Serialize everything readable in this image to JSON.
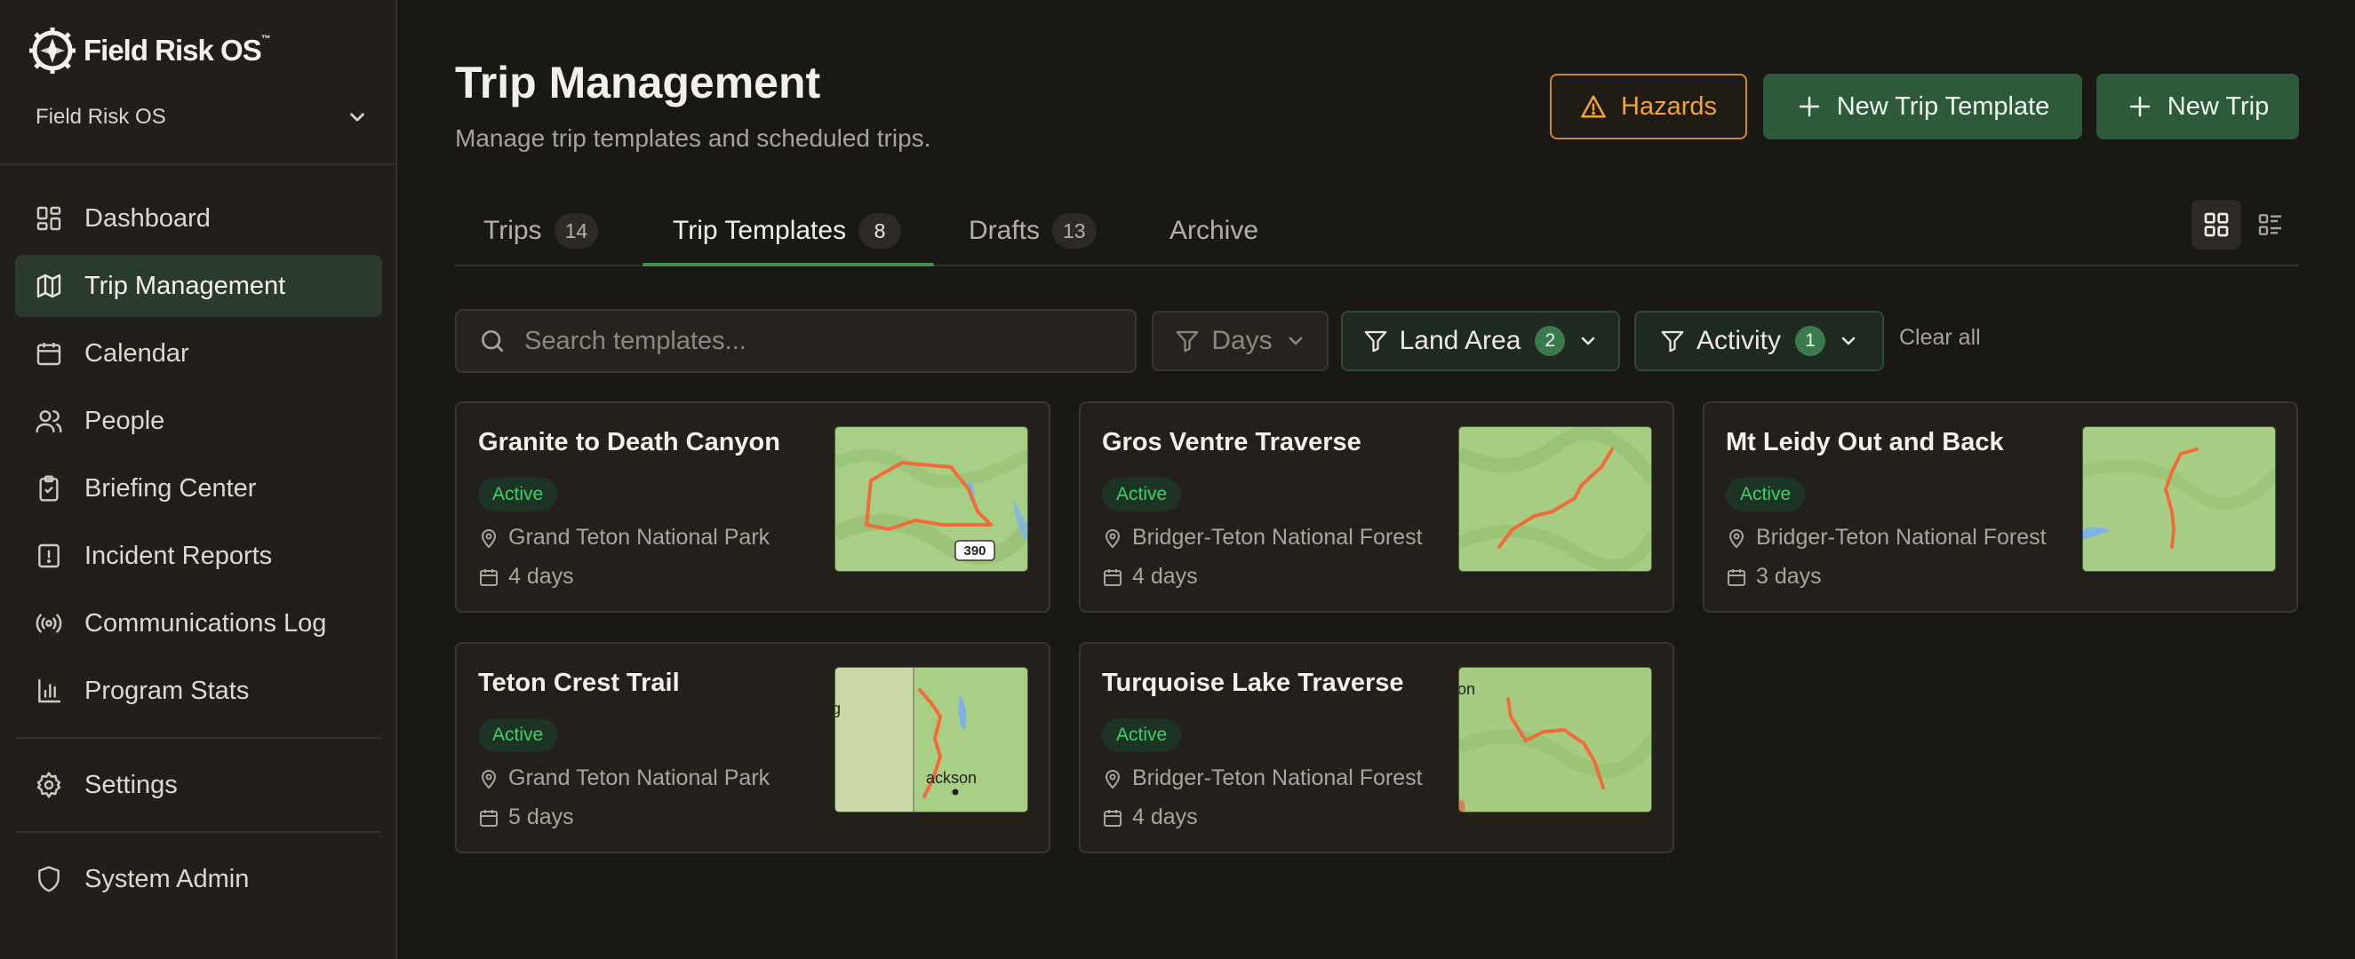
{
  "brand": {
    "name": "Field Risk OS",
    "trademark": "™"
  },
  "org": {
    "name": "Field Risk OS"
  },
  "nav": {
    "items": [
      {
        "label": "Dashboard",
        "icon": "dashboard-icon"
      },
      {
        "label": "Trip Management",
        "icon": "map-icon",
        "active": true
      },
      {
        "label": "Calendar",
        "icon": "calendar-icon"
      },
      {
        "label": "People",
        "icon": "people-icon"
      },
      {
        "label": "Briefing Center",
        "icon": "clipboard-check-icon"
      },
      {
        "label": "Incident Reports",
        "icon": "report-alert-icon"
      },
      {
        "label": "Communications Log",
        "icon": "radio-icon"
      },
      {
        "label": "Program Stats",
        "icon": "bar-chart-icon"
      }
    ],
    "settings": {
      "label": "Settings",
      "icon": "gear-icon"
    },
    "admin": {
      "label": "System Admin",
      "icon": "shield-icon"
    }
  },
  "header": {
    "title": "Trip Management",
    "subtitle": "Manage trip templates and scheduled trips.",
    "hazards_label": "Hazards",
    "new_template_label": "New Trip Template",
    "new_trip_label": "New Trip"
  },
  "tabs": [
    {
      "label": "Trips",
      "count": "14"
    },
    {
      "label": "Trip Templates",
      "count": "8",
      "active": true
    },
    {
      "label": "Drafts",
      "count": "13"
    },
    {
      "label": "Archive",
      "count": ""
    }
  ],
  "view_toggle": {
    "selected": "grid"
  },
  "search": {
    "placeholder": "Search templates...",
    "value": ""
  },
  "filters": {
    "days": {
      "label": "Days",
      "count": ""
    },
    "land_area": {
      "label": "Land Area",
      "count": "2"
    },
    "activity": {
      "label": "Activity",
      "count": "1"
    },
    "clear_label": "Clear all"
  },
  "cards": [
    {
      "title": "Granite to Death Canyon",
      "status": "Active",
      "location": "Grand Teton National Park",
      "duration": "4 days",
      "map_label": "390"
    },
    {
      "title": "Gros Ventre Traverse",
      "status": "Active",
      "location": "Bridger-Teton National Forest",
      "duration": "4 days"
    },
    {
      "title": "Mt Leidy Out and Back",
      "status": "Active",
      "location": "Bridger-Teton National Forest",
      "duration": "3 days"
    },
    {
      "title": "Teton Crest Trail",
      "status": "Active",
      "location": "Grand Teton National Park",
      "duration": "5 days",
      "map_label": "ackson",
      "map_edge_label": "g"
    },
    {
      "title": "Turquoise Lake Traverse",
      "status": "Active",
      "location": "Bridger-Teton National Forest",
      "duration": "4 days",
      "map_edge_label": "on"
    }
  ],
  "colors": {
    "accent_green": "#2d5a3a",
    "hazard_orange": "#f2a33a",
    "active_badge": "#3fcf6b",
    "route": "#f26b3a"
  }
}
